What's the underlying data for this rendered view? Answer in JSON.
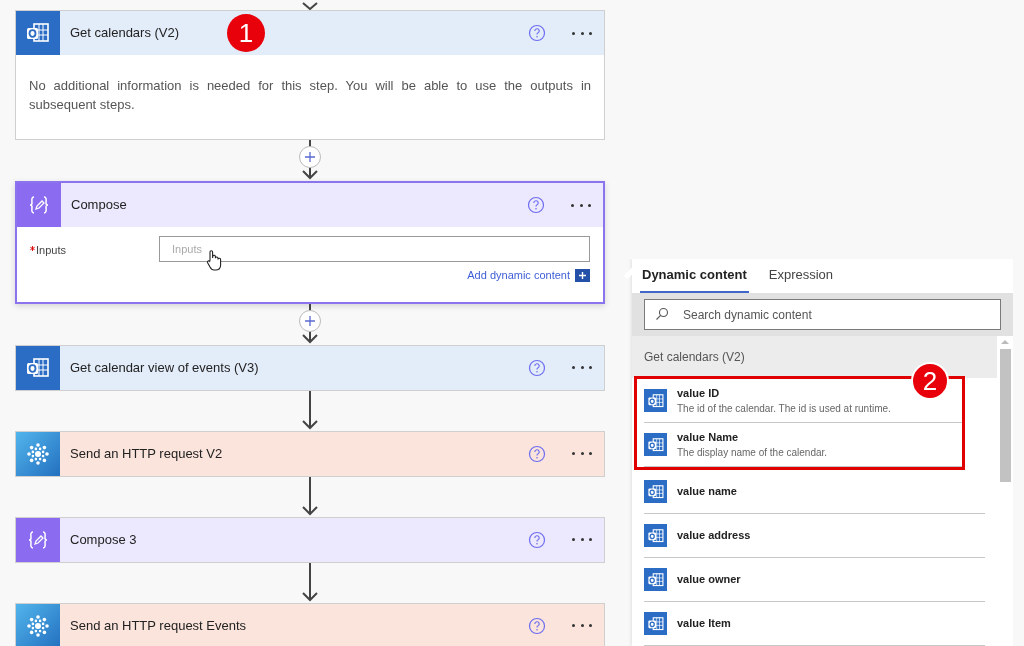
{
  "steps": [
    {
      "kind": "outlook",
      "title": "Get calendars (V2)",
      "selected": false,
      "callout": "1",
      "body": "No additional information is needed for this step. You will be able to use the outputs in subsequent steps.",
      "add_button": true
    },
    {
      "kind": "compose",
      "title": "Compose",
      "selected": true,
      "field": {
        "label": "Inputs",
        "required": true,
        "placeholder": "Inputs"
      },
      "link": "Add dynamic content",
      "add_button": true
    },
    {
      "kind": "outlook",
      "title": "Get calendar view of events (V3)",
      "selected": false,
      "add_button": false
    },
    {
      "kind": "http",
      "title": "Send an HTTP request V2",
      "selected": false,
      "add_button": false
    },
    {
      "kind": "compose",
      "title": "Compose 3",
      "selected": false,
      "add_button": false
    },
    {
      "kind": "http",
      "title": "Send an HTTP request Events",
      "selected": false
    }
  ],
  "panel": {
    "tabs": [
      {
        "label": "Dynamic content",
        "selected": true
      },
      {
        "label": "Expression",
        "selected": false
      }
    ],
    "search": {
      "placeholder": "Search dynamic content"
    },
    "group": "Get calendars (V2)",
    "callout": "2",
    "highlighted_items": [
      {
        "title": "value ID",
        "description": "The id of the calendar. The id is used at runtime."
      },
      {
        "title": "value Name",
        "description": "The display name of the calendar."
      }
    ],
    "items": [
      {
        "title": "value name"
      },
      {
        "title": "value address"
      },
      {
        "title": "value owner"
      },
      {
        "title": "value Item"
      }
    ]
  }
}
